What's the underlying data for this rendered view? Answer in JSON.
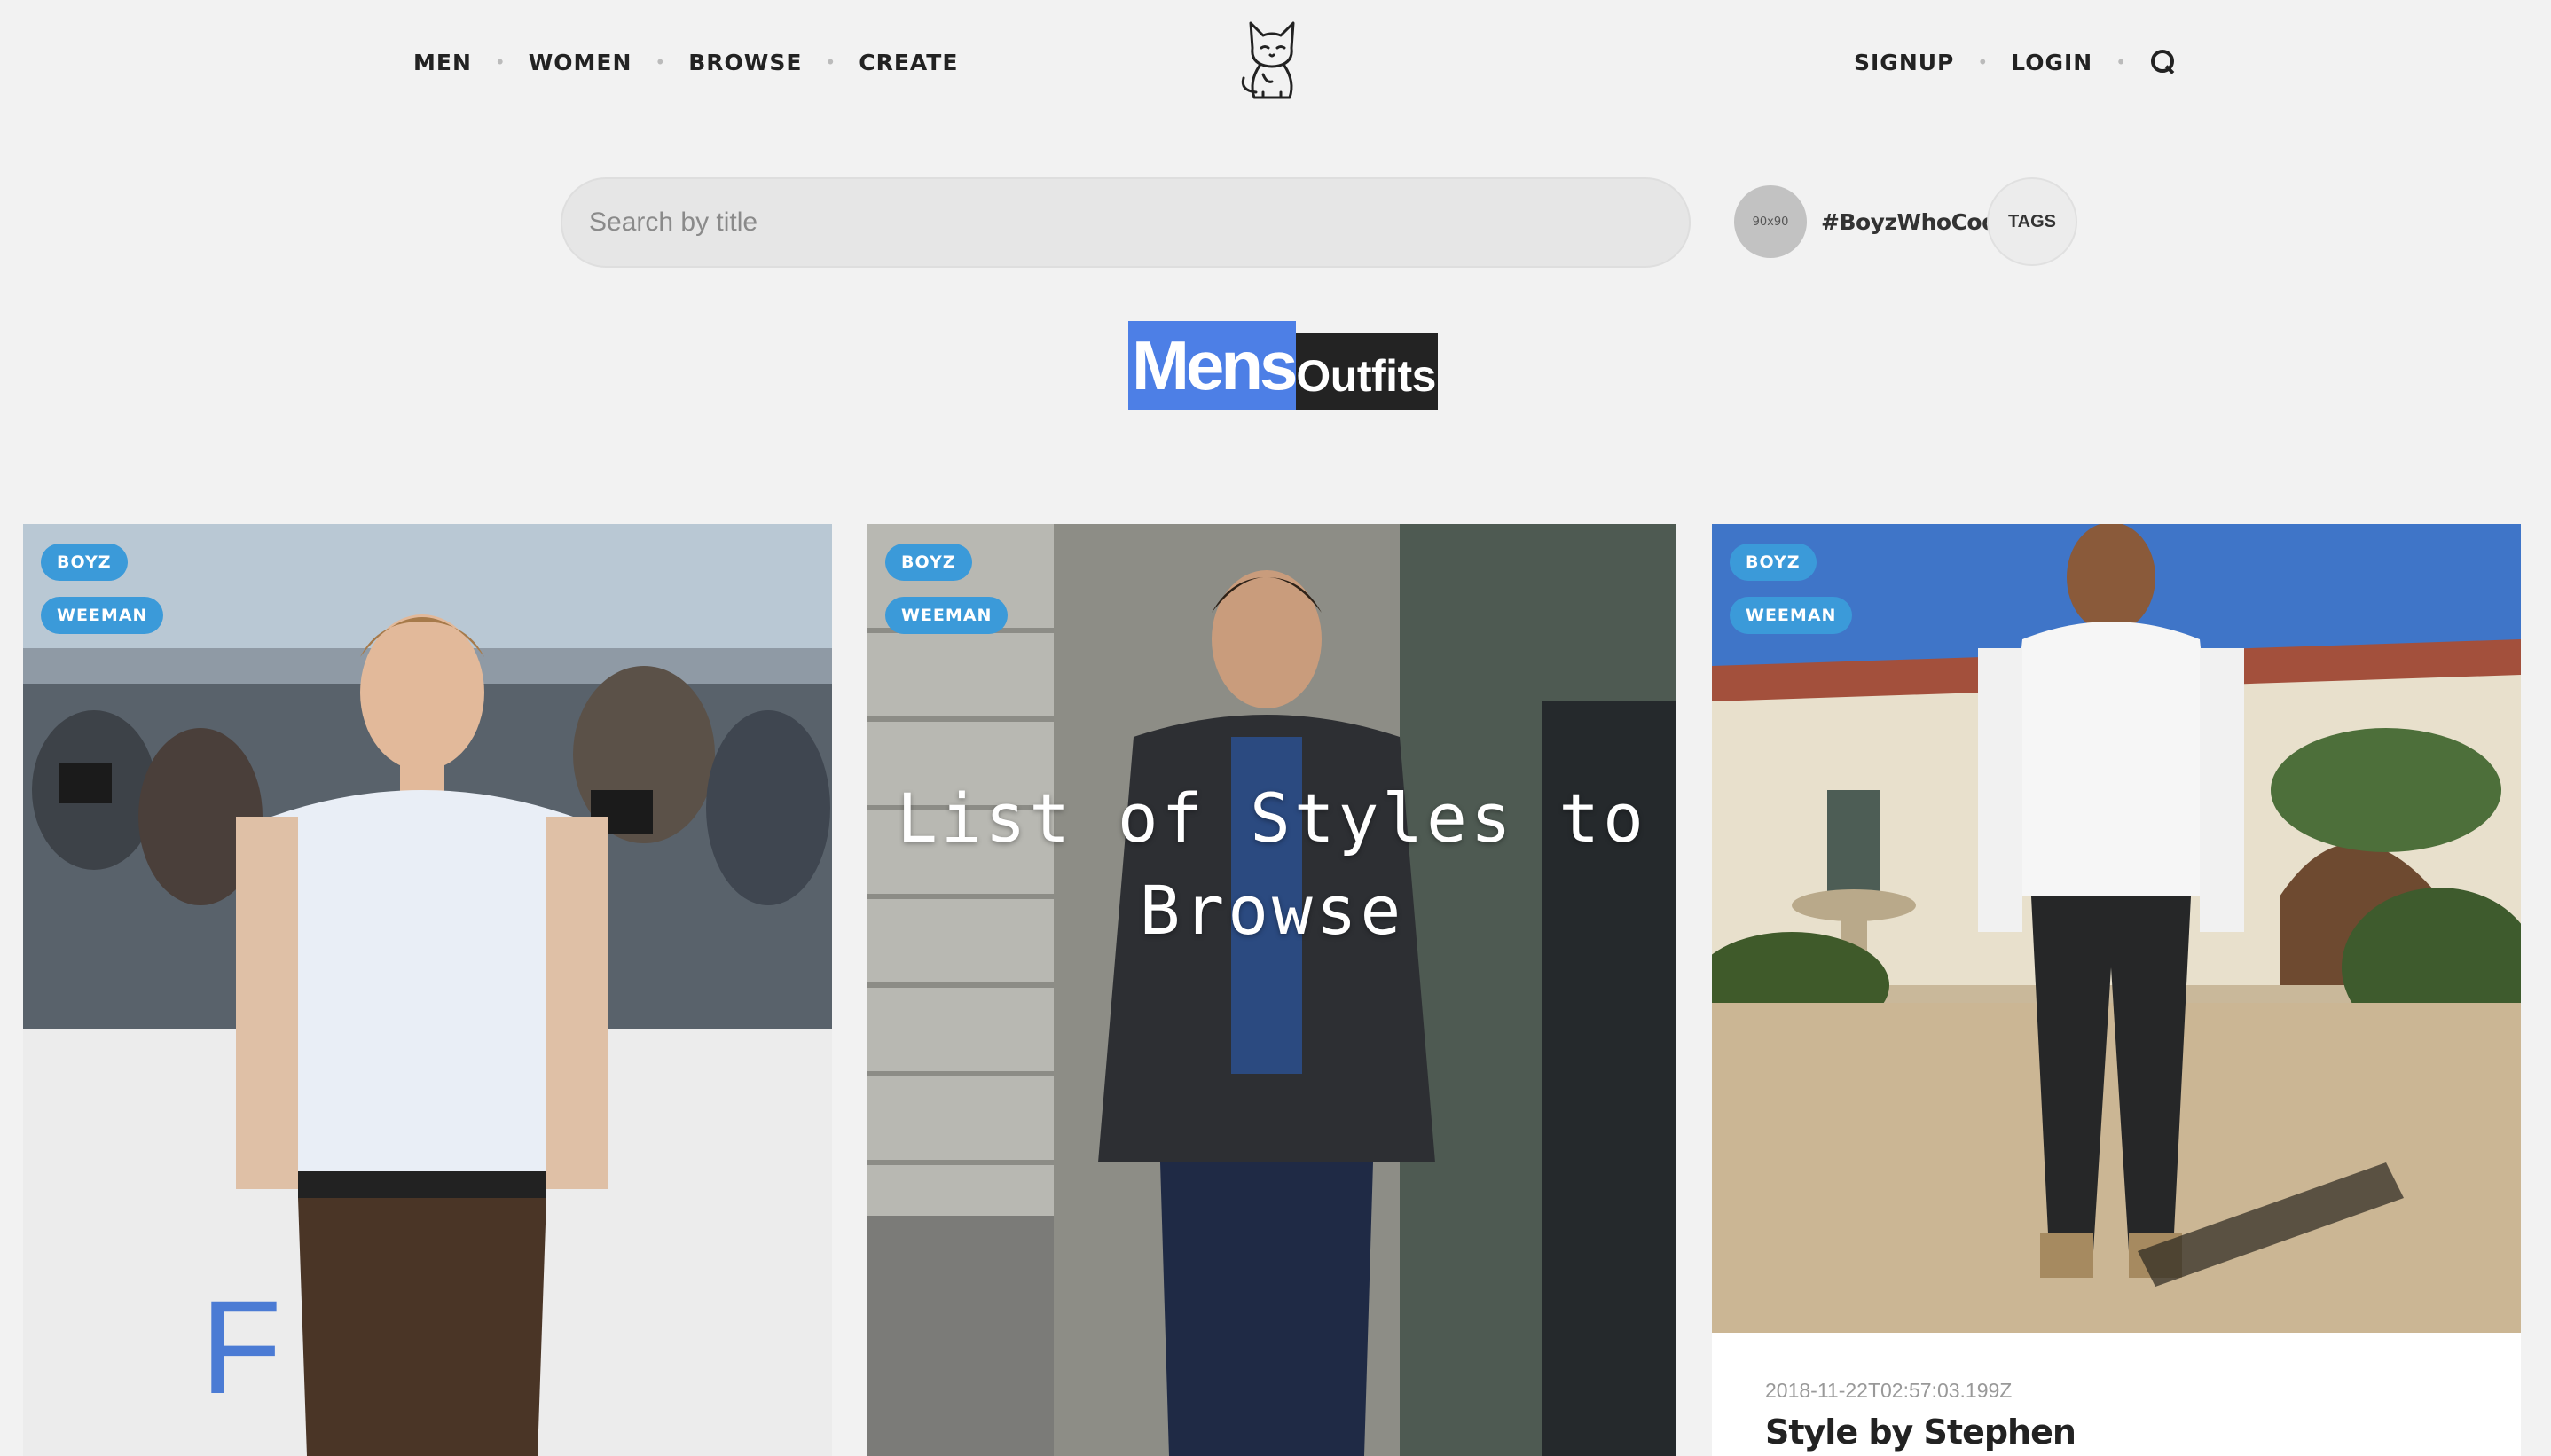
{
  "nav": {
    "left": [
      "MEN",
      "WOMEN",
      "BROWSE",
      "CREATE"
    ],
    "right": [
      "SIGNUP",
      "LOGIN"
    ],
    "search_icon": "search-icon",
    "logo": "cat-logo"
  },
  "search": {
    "placeholder": "Search by title",
    "tag_avatar_text": "90x90",
    "tag_name": "#BoyzWhoCode",
    "tags_button": "TAGS"
  },
  "heading": {
    "strong": "Mens",
    "light": "Outfits"
  },
  "colors": {
    "accent_blue": "#4d7fe6",
    "badge_blue": "#3b9ad9",
    "dark": "#232323",
    "background": "#f2f2f2"
  },
  "cards": [
    {
      "badges": [
        "BOYZ",
        "WEEMAN"
      ],
      "overlay_title": "",
      "date": "",
      "title": ""
    },
    {
      "badges": [
        "BOYZ",
        "WEEMAN"
      ],
      "overlay_title": "List of Styles to Browse",
      "date": "",
      "title": ""
    },
    {
      "badges": [
        "BOYZ",
        "WEEMAN"
      ],
      "overlay_title": "",
      "date": "2018-11-22T02:57:03.199Z",
      "title": "Style by Stephen"
    }
  ]
}
